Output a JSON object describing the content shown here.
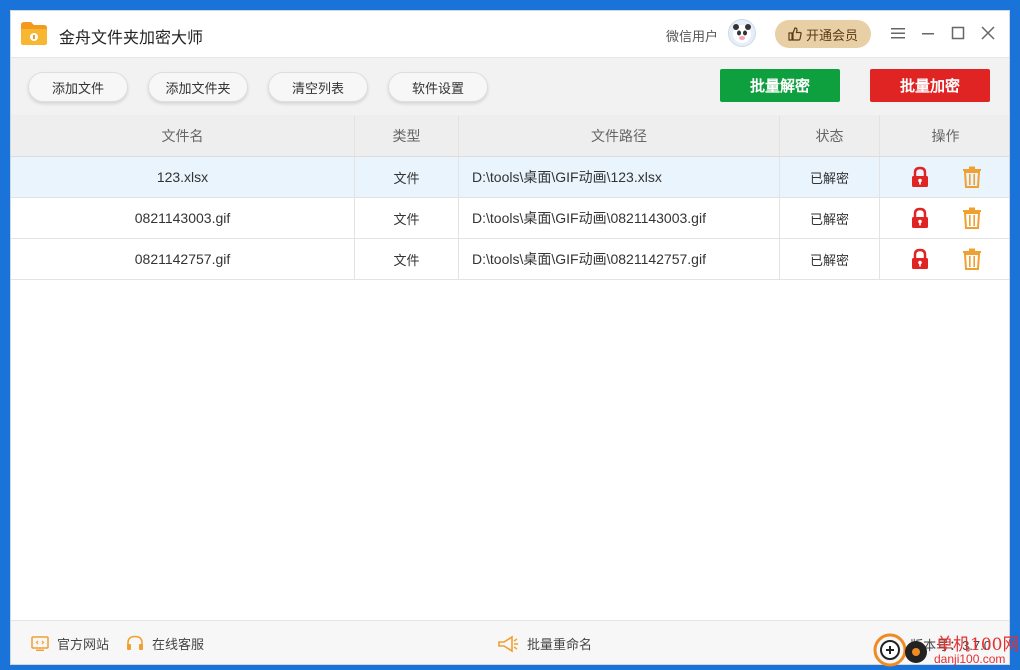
{
  "app": {
    "title": "金舟文件夹加密大师"
  },
  "user": {
    "name": "微信用户",
    "vip_label": "开通会员"
  },
  "toolbar": {
    "add_file": "添加文件",
    "add_folder": "添加文件夹",
    "clear_list": "清空列表",
    "settings": "软件设置",
    "batch_decrypt": "批量解密",
    "batch_encrypt": "批量加密"
  },
  "colors": {
    "decrypt": "#0e9f3f",
    "encrypt": "#e02323",
    "vip": "#e9cfa6",
    "lock": "#e02323",
    "trash": "#f0a030"
  },
  "table": {
    "headers": [
      "文件名",
      "类型",
      "文件路径",
      "状态",
      "操作"
    ],
    "rows": [
      {
        "name": "123.xlsx",
        "type": "文件",
        "path": "D:\\tools\\桌面\\GIF动画\\123.xlsx",
        "status": "已解密"
      },
      {
        "name": "0821143003.gif",
        "type": "文件",
        "path": "D:\\tools\\桌面\\GIF动画\\0821143003.gif",
        "status": "已解密"
      },
      {
        "name": "0821142757.gif",
        "type": "文件",
        "path": "D:\\tools\\桌面\\GIF动画\\0821142757.gif",
        "status": "已解密"
      }
    ]
  },
  "statusbar": {
    "website": "官方网站",
    "support": "在线客服",
    "batch_rename": "批量重命名",
    "version": "版本号：3.7.0"
  },
  "watermark": {
    "site": "单机100网",
    "domain": "danji100.com"
  }
}
